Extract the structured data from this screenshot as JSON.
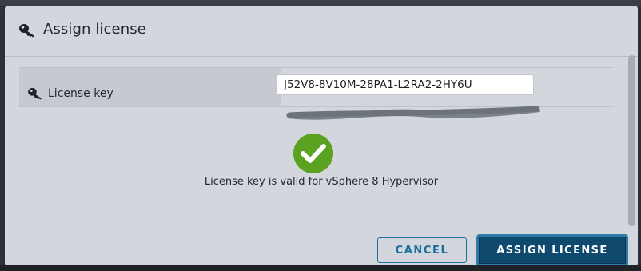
{
  "dialog": {
    "title": "Assign license",
    "title_icon": "key-icon",
    "field_label": "License key",
    "field_icon": "key-icon",
    "license_key_value": "J52V8-8V10M-28PA1-L2RA2-2HY6U",
    "status_icon": "check-circle-icon",
    "status_message": "License key is valid for vSphere 8 Hypervisor",
    "cancel_label": "CANCEL",
    "assign_label": "ASSIGN LICENSE"
  },
  "colors": {
    "dialog_background": "#d4d6dd",
    "success_green": "#5aa220",
    "primary_blue": "#0f4a6e",
    "outline_blue": "#1b6f9e"
  }
}
